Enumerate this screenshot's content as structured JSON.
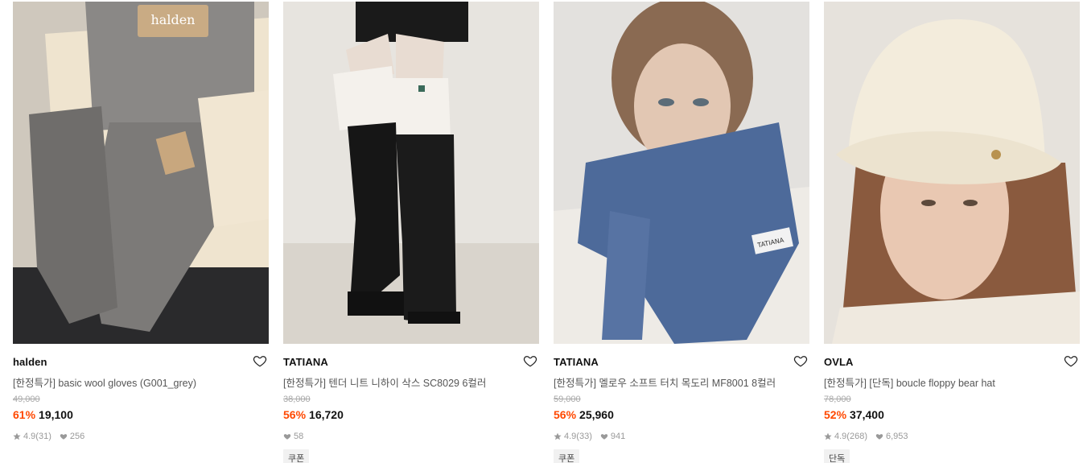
{
  "products": [
    {
      "brand": "halden",
      "title": "[한정특가] basic wool gloves (G001_grey)",
      "original_price": "49,000",
      "discount": "61%",
      "price": "19,100",
      "rating": "4.9",
      "review_count": "(31)",
      "likes": "256",
      "badge": "",
      "image_label": "halden"
    },
    {
      "brand": "TATIANA",
      "title": "[한정특가] 텐더 니트 니하이 삭스 SC8029 6컬러",
      "original_price": "38,000",
      "discount": "56%",
      "price": "16,720",
      "rating": "",
      "review_count": "",
      "likes": "58",
      "badge": "쿠폰",
      "image_label": ""
    },
    {
      "brand": "TATIANA",
      "title": "[한정특가] 멜로우 소프트 터치 목도리 MF8001 8컬러",
      "original_price": "59,000",
      "discount": "56%",
      "price": "25,960",
      "rating": "4.9",
      "review_count": "(33)",
      "likes": "941",
      "badge": "쿠폰",
      "image_label": "TATIANA"
    },
    {
      "brand": "OVLA",
      "title": "[한정특가] [단독] boucle floppy bear hat",
      "original_price": "78,000",
      "discount": "52%",
      "price": "37,400",
      "rating": "4.9",
      "review_count": "(268)",
      "likes": "6,953",
      "badge": "단독",
      "image_label": ""
    }
  ],
  "colors": {
    "discount": "#ff4800",
    "muted": "#999999",
    "badge_bg": "#f1f1f1"
  },
  "icons": {
    "wishlist": "heart-outline-icon",
    "rating": "star-icon",
    "likes": "heart-filled-icon"
  }
}
